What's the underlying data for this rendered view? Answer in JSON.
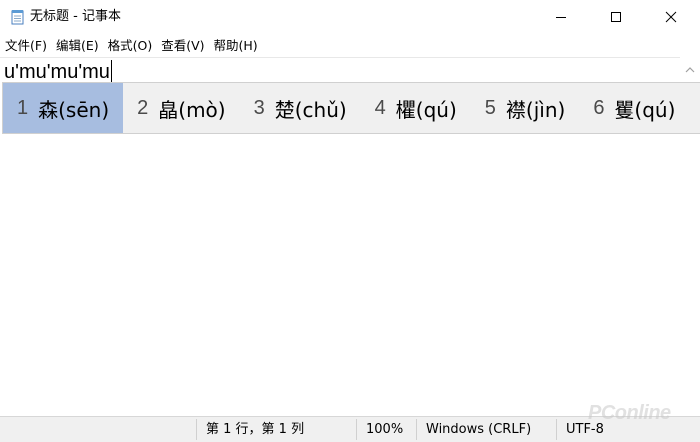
{
  "window": {
    "title": "无标题 - 记事本"
  },
  "menu": {
    "items": [
      {
        "label": "文件(F)"
      },
      {
        "label": "编辑(E)"
      },
      {
        "label": "格式(O)"
      },
      {
        "label": "查看(V)"
      },
      {
        "label": "帮助(H)"
      }
    ]
  },
  "editor": {
    "text": "u'mu'mu'mu"
  },
  "ime": {
    "candidates": [
      {
        "index": "1",
        "text": "森(sēn)",
        "selected": true
      },
      {
        "index": "2",
        "text": "皛(mò)",
        "selected": false
      },
      {
        "index": "3",
        "text": "楚(chǔ)",
        "selected": false
      },
      {
        "index": "4",
        "text": "欋(qú)",
        "selected": false
      },
      {
        "index": "5",
        "text": "襟(jìn)",
        "selected": false
      },
      {
        "index": "6",
        "text": "矍(qú)",
        "selected": false
      }
    ],
    "selected_color": "#a7bde0"
  },
  "status": {
    "position": "第 1 行，第 1 列",
    "zoom": "100%",
    "line_ending": "Windows (CRLF)",
    "encoding": "UTF-8"
  },
  "watermark": "PConline",
  "icons": {
    "app": "notepad-icon",
    "minimize": "minimize-icon",
    "maximize": "maximize-icon",
    "close": "close-icon",
    "scroll_up": "scroll-up-arrow-icon"
  }
}
